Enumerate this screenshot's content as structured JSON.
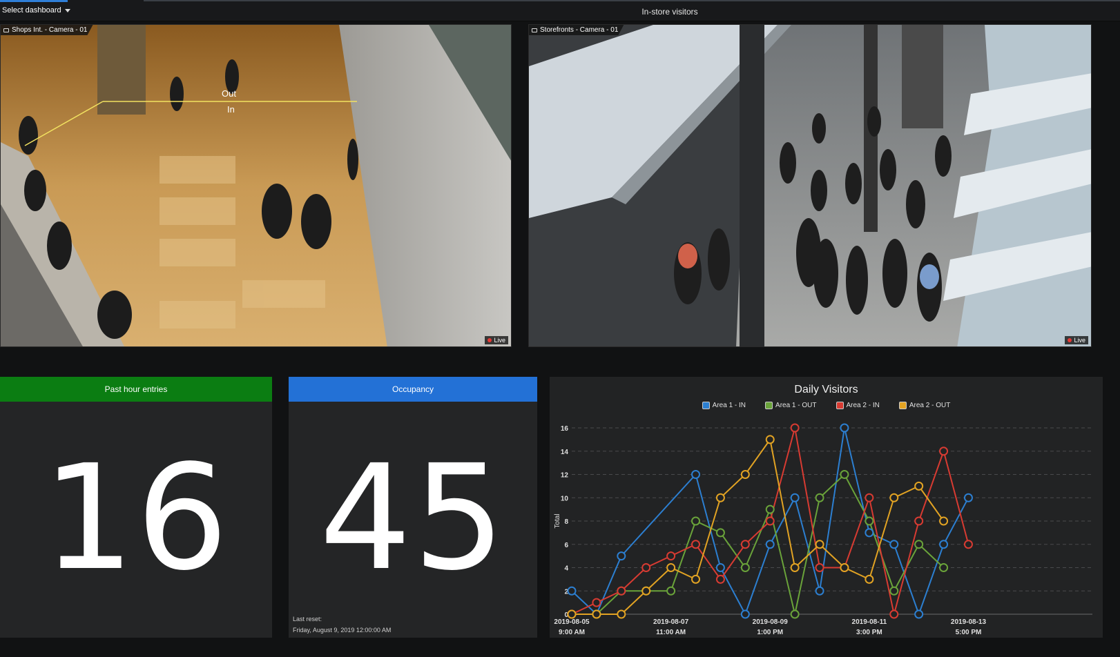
{
  "header": {
    "select_dashboard": "Select dashboard",
    "title": "In-store visitors"
  },
  "cameras": [
    {
      "label": "Shops Int. - Camera - 01",
      "live": "Live",
      "overlay": {
        "out": "Out",
        "in": "In"
      }
    },
    {
      "label": "Storefronts - Camera - 01",
      "live": "Live"
    }
  ],
  "tiles": {
    "entries": {
      "title": "Past hour entries",
      "value": "16",
      "color": "#0b7d12"
    },
    "occupancy": {
      "title": "Occupancy",
      "value": "45",
      "color": "#2371d6",
      "reset_label": "Last reset:",
      "reset_value": "Friday, August 9, 2019 12:00:00 AM"
    }
  },
  "chart_data": {
    "type": "line",
    "title": "Daily Visitors",
    "ylabel": "Total",
    "xlabel": "",
    "ylim": [
      0,
      16
    ],
    "yticks": [
      0,
      2,
      4,
      6,
      8,
      10,
      12,
      14,
      16
    ],
    "grid": true,
    "legend_position": "top",
    "x": [
      0,
      1,
      2,
      3,
      4,
      5,
      6,
      7,
      8,
      9,
      10,
      11,
      12,
      13,
      14,
      15,
      16,
      17,
      18,
      19,
      20,
      21
    ],
    "x_tick_labels": [
      {
        "at": 0,
        "date": "2019-08-05",
        "time": "9:00 AM"
      },
      {
        "at": 4,
        "date": "2019-08-07",
        "time": "11:00 AM"
      },
      {
        "at": 8,
        "date": "2019-08-09",
        "time": "1:00 PM"
      },
      {
        "at": 12,
        "date": "2019-08-11",
        "time": "3:00 PM"
      },
      {
        "at": 16,
        "date": "2019-08-13",
        "time": "5:00 PM"
      }
    ],
    "series": [
      {
        "name": "Area 1 - IN",
        "color": "#2c7fd1",
        "points": [
          [
            0,
            2
          ],
          [
            1,
            0
          ],
          [
            2,
            5
          ],
          [
            5,
            12
          ],
          [
            6,
            4
          ],
          [
            7,
            0
          ],
          [
            8,
            6
          ],
          [
            9,
            10
          ],
          [
            10,
            2
          ],
          [
            11,
            16
          ],
          [
            12,
            7
          ],
          [
            13,
            6
          ],
          [
            14,
            0
          ],
          [
            15,
            6
          ],
          [
            16,
            10
          ]
        ]
      },
      {
        "name": "Area 1 - OUT",
        "color": "#6aa33a",
        "points": [
          [
            0,
            0
          ],
          [
            1,
            0
          ],
          [
            2,
            2
          ],
          [
            3,
            2
          ],
          [
            4,
            2
          ],
          [
            5,
            8
          ],
          [
            6,
            7
          ],
          [
            7,
            4
          ],
          [
            8,
            9
          ],
          [
            9,
            0
          ],
          [
            10,
            10
          ],
          [
            11,
            12
          ],
          [
            12,
            8
          ],
          [
            13,
            2
          ],
          [
            14,
            6
          ],
          [
            15,
            4
          ]
        ]
      },
      {
        "name": "Area 2 - IN",
        "color": "#d83b32",
        "points": [
          [
            0,
            0
          ],
          [
            1,
            1
          ],
          [
            2,
            2
          ],
          [
            3,
            4
          ],
          [
            4,
            5
          ],
          [
            5,
            6
          ],
          [
            6,
            3
          ],
          [
            7,
            6
          ],
          [
            8,
            8
          ],
          [
            9,
            16
          ],
          [
            10,
            4
          ],
          [
            11,
            4
          ],
          [
            12,
            10
          ],
          [
            13,
            0
          ],
          [
            14,
            8
          ],
          [
            15,
            14
          ],
          [
            16,
            6
          ]
        ]
      },
      {
        "name": "Area 2 - OUT",
        "color": "#e2a323",
        "points": [
          [
            0,
            0
          ],
          [
            1,
            0
          ],
          [
            2,
            0
          ],
          [
            3,
            2
          ],
          [
            4,
            4
          ],
          [
            5,
            3
          ],
          [
            6,
            10
          ],
          [
            7,
            12
          ],
          [
            8,
            15
          ],
          [
            9,
            4
          ],
          [
            10,
            6
          ],
          [
            11,
            4
          ],
          [
            12,
            3
          ],
          [
            13,
            10
          ],
          [
            14,
            11
          ],
          [
            15,
            8
          ]
        ]
      }
    ]
  }
}
